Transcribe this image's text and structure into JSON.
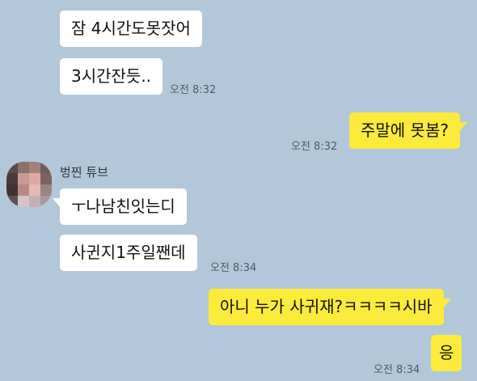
{
  "chat": {
    "messages": [
      {
        "text": "잠 4시간도못잣어",
        "sender": "other"
      },
      {
        "text": "3시간잔듯..",
        "sender": "other",
        "time": "오전 8:32"
      },
      {
        "text": "주말에 못봄?",
        "sender": "me",
        "time": "오전 8:32"
      },
      {
        "text": "ㅜ나남친잇는디",
        "sender": "other"
      },
      {
        "text": "사귄지1주일짼데",
        "sender": "other",
        "time": "오전 8:34"
      },
      {
        "text": "아니 누가 사귀재?ㅋㅋㅋㅋ시바",
        "sender": "me"
      },
      {
        "text": "응",
        "sender": "me",
        "time": "오전 8:34"
      }
    ],
    "other_user": {
      "name": "벙찐 튜브",
      "avatar_icon": "blurred-profile-photo"
    }
  },
  "colors": {
    "background": "#b2c7d9",
    "incoming_bubble": "#ffffff",
    "outgoing_bubble": "#fdeb3b",
    "timestamp_text": "#4e5a66"
  }
}
